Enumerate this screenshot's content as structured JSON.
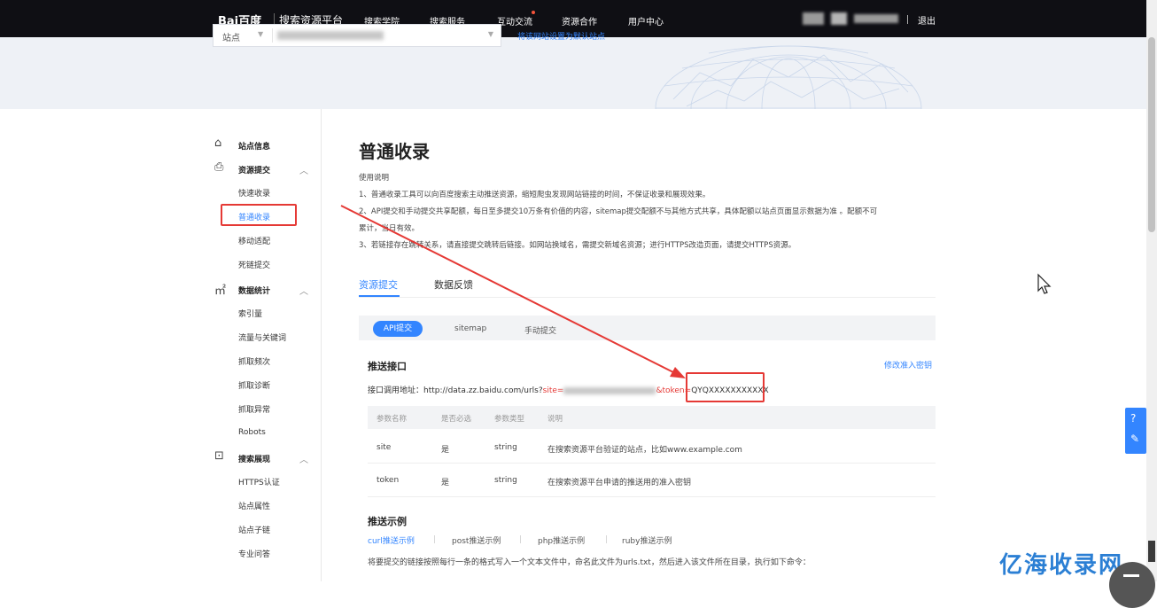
{
  "header": {
    "logo_text": "Bai百度",
    "platform": "搜索资源平台",
    "nav": [
      "搜索学院",
      "搜索服务",
      "互动交流",
      "资源合作",
      "用户中心"
    ],
    "logout": "退出"
  },
  "siteBar": {
    "site_label": "站点",
    "set_default": "将该网站设置为默认站点"
  },
  "sidebar": {
    "home": "站点信息",
    "groups": [
      {
        "title": "资源提交",
        "icon": "resource-icon",
        "items": [
          "快速收录",
          "普通收录",
          "移动适配",
          "死链提交"
        ]
      },
      {
        "title": "数据统计",
        "icon": "chart-icon",
        "items": [
          "索引量",
          "流量与关键词",
          "抓取频次",
          "抓取诊断",
          "抓取异常",
          "Robots"
        ]
      },
      {
        "title": "搜索展现",
        "icon": "search-display-icon",
        "items": [
          "HTTPS认证",
          "站点属性",
          "站点子链",
          "专业问答"
        ]
      }
    ],
    "active_item": "普通收录"
  },
  "main": {
    "title": "普通收录",
    "usage_title": "使用说明",
    "usage_lines": [
      "1、普通收录工具可以向百度搜索主动推送资源，缩短爬虫发现网站链接的时间，不保证收录和展现效果。",
      "2、API提交和手动提交共享配额，每日至多提交10万条有价值的内容，sitemap提交配额不与其他方式共享，具体配额以站点页面显示数据为准 。配额不可",
      "累计，当日有效。",
      "3、若链接存在跳转关系，请直接提交跳转后链接。如网站换域名，需提交新域名资源；进行HTTPS改造页面，请提交HTTPS资源。"
    ],
    "tabs": [
      "资源提交",
      "数据反馈"
    ],
    "subtabs": [
      "API提交",
      "sitemap",
      "手动提交"
    ],
    "push_title": "推送接口",
    "modify_token": "修改准入密钥",
    "url_label": "接口调用地址：http://data.zz.baidu.com/urls?",
    "url_site_param": "site=",
    "url_token_param": "&token=",
    "url_token_value": "QYQXXXXXXXXXXX",
    "table_headers": [
      "参数名称",
      "是否必选",
      "参数类型",
      "说明"
    ],
    "table_rows": [
      [
        "site",
        "是",
        "string",
        "在搜索资源平台验证的站点，比如www.example.com"
      ],
      [
        "token",
        "是",
        "string",
        "在搜索资源平台申请的推送用的准入密钥"
      ]
    ],
    "example_title": "推送示例",
    "example_links": [
      "curl推送示例",
      "post推送示例",
      "php推送示例",
      "ruby推送示例"
    ],
    "bottom_note": "将要提交的链接按照每行一条的格式写入一个文本文件中，命名此文件为urls.txt，然后进入该文件所在目录，执行如下命令："
  },
  "watermark": "亿海收录网",
  "colors": {
    "accent": "#3385ff",
    "annotation": "#e53935",
    "topbar": "#0f0f14"
  }
}
